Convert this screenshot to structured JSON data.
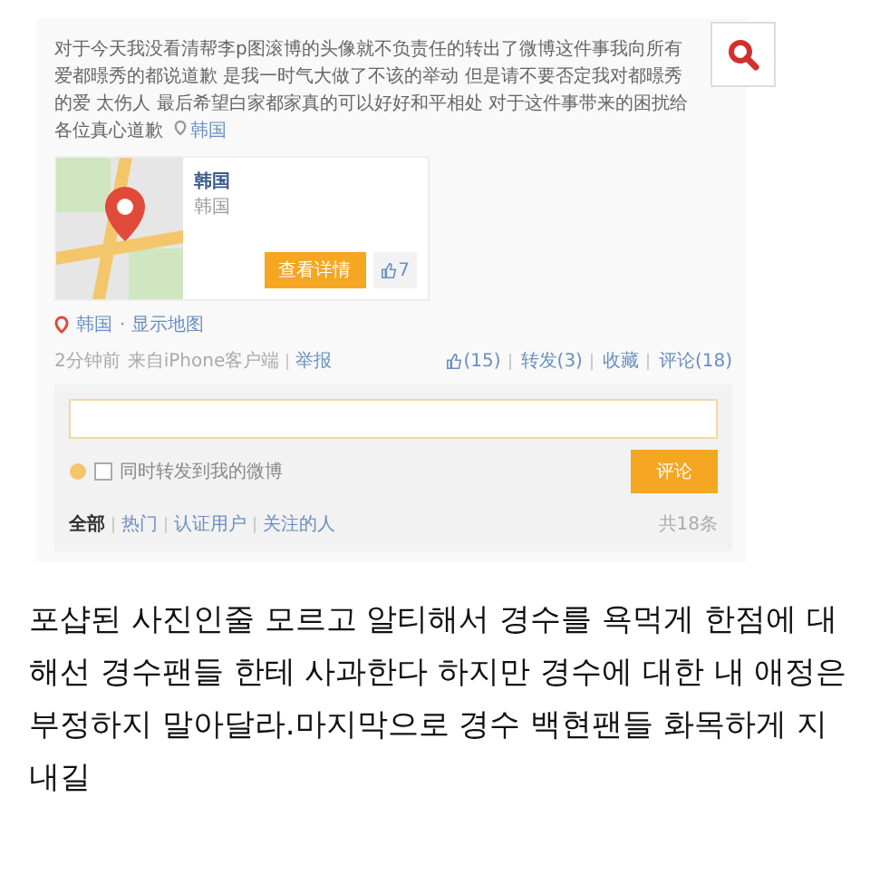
{
  "post": {
    "text": "对于今天我没看清帮李p图滚博的头像就不负责任的转出了微博这件事我向所有爱都暻秀的都说道歉 是我一时气大做了不该的举动 但是请不要否定我对都暻秀的爱 太伤人 最后希望白家都家真的可以好好和平相处 对于这件事带来的困扰给各位真心道歉",
    "location_tag": "韩国"
  },
  "location_card": {
    "title": "韩国",
    "subtitle": "韩国",
    "button": "查看详情",
    "likes": "7"
  },
  "location_line": {
    "place": "韩国",
    "link": "· 显示地图"
  },
  "meta": {
    "time": "2分钟前",
    "source": "来自iPhone客户端",
    "report": "举报"
  },
  "actions": [
    {
      "label": "(15)",
      "kind": "like"
    },
    {
      "label": "转发(3)",
      "kind": "text"
    },
    {
      "label": "收藏",
      "kind": "text"
    },
    {
      "label": "评论(18)",
      "kind": "text"
    }
  ],
  "comment_box": {
    "checkbox_label": "同时转发到我的微博",
    "checked": false,
    "submit": "评论"
  },
  "filters": [
    {
      "label": "全部",
      "selected": true
    },
    {
      "label": "热门",
      "selected": false
    },
    {
      "label": "认证用户",
      "selected": false
    },
    {
      "label": "关注的人",
      "selected": false
    }
  ],
  "count": "共18条",
  "caption": "포샵된 사진인줄 모르고 알티해서 경수를 욕먹게 한점에 대해선 경수팬들 한테 사과한다 하지만 경수에 대한 내 애정은 부정하지 말아달라.마지막으로 경수 백현팬들 화목하게 지내길"
}
